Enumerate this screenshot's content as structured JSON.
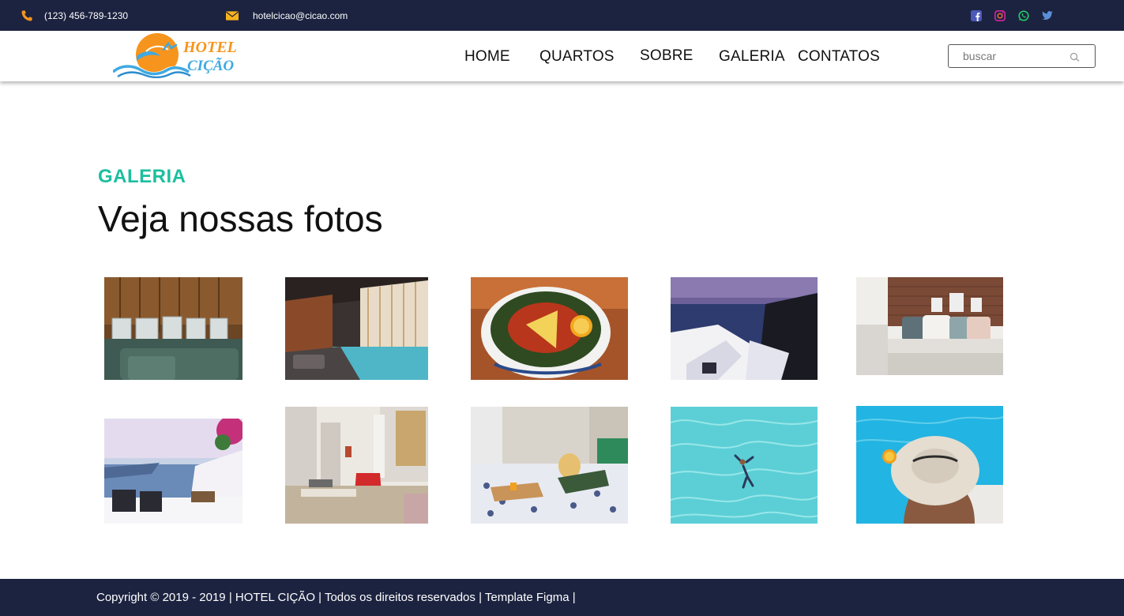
{
  "topbar": {
    "phone": "(123) 456-789-1230",
    "email": "hotelcicao@cicao.com",
    "social": [
      "facebook-icon",
      "instagram-icon",
      "whatsapp-icon",
      "twitter-icon"
    ],
    "colors": {
      "background": "#1c2340",
      "accent": "#f7941d",
      "facebook": "#3b5998",
      "instagram": "#c13584",
      "whatsapp": "#25d366",
      "twitter": "#1da1f2"
    }
  },
  "logo": {
    "line1": "HOTEL",
    "line2": "CIÇÃO"
  },
  "nav": {
    "home": "HOME",
    "quartos": "QUARTOS",
    "sobre": "SOBRE",
    "galeria": "GALERIA",
    "contatos": "CONTATOS"
  },
  "search": {
    "placeholder": "buscar"
  },
  "section": {
    "kicker": "GALERIA",
    "title": "Veja nossas fotos",
    "kicker_color": "#1bbf9f"
  },
  "gallery": [
    "hotel-sign-photo",
    "indoor-pool-photo",
    "food-bowl-photo",
    "coastal-village-photo",
    "bedroom-photo",
    "sea-terrace-photo",
    "apartment-photo",
    "breakfast-in-bed-photo",
    "swimmer-pool-photo",
    "hat-by-pool-photo"
  ],
  "footer": {
    "copyright": "Copyright © 2019 - 2019 | HOTEL CIÇÃO | Todos os direitos reservados | Template Figma |"
  }
}
